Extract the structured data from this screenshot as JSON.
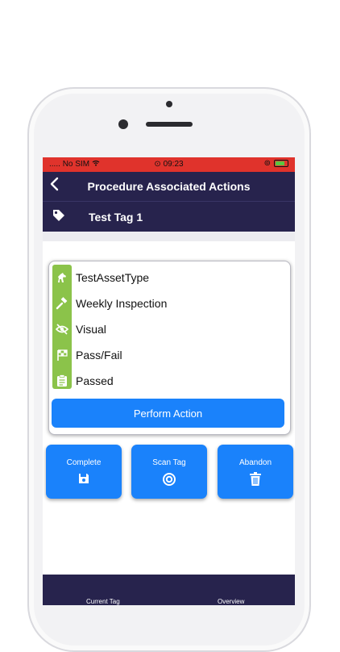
{
  "status_bar": {
    "carrier": "No SIM",
    "time": "09:23"
  },
  "nav": {
    "title": "Procedure Associated Actions",
    "back_icon": "chevron-left-icon"
  },
  "tag": {
    "name": "Test Tag 1",
    "icon": "tag-icon"
  },
  "details": [
    {
      "icon": "horse-icon",
      "text": "TestAssetType"
    },
    {
      "icon": "gavel-icon",
      "text": "Weekly Inspection"
    },
    {
      "icon": "eye-slash-icon",
      "text": "Visual"
    },
    {
      "icon": "checkered-flag-icon",
      "text": "Pass/Fail"
    },
    {
      "icon": "clipboard-icon",
      "text": "Passed"
    }
  ],
  "perform_label": "Perform Action",
  "actions": [
    {
      "label": "Complete",
      "icon": "save-icon"
    },
    {
      "label": "Scan Tag",
      "icon": "target-icon"
    },
    {
      "label": "Abandon",
      "icon": "trash-icon"
    }
  ],
  "tabs": [
    {
      "label": "Current Tag"
    },
    {
      "label": "Overview"
    }
  ],
  "colors": {
    "navy": "#27234d",
    "accent_blue": "#1a82fb",
    "green": "#8bc34a",
    "status_red": "#e0332c"
  }
}
